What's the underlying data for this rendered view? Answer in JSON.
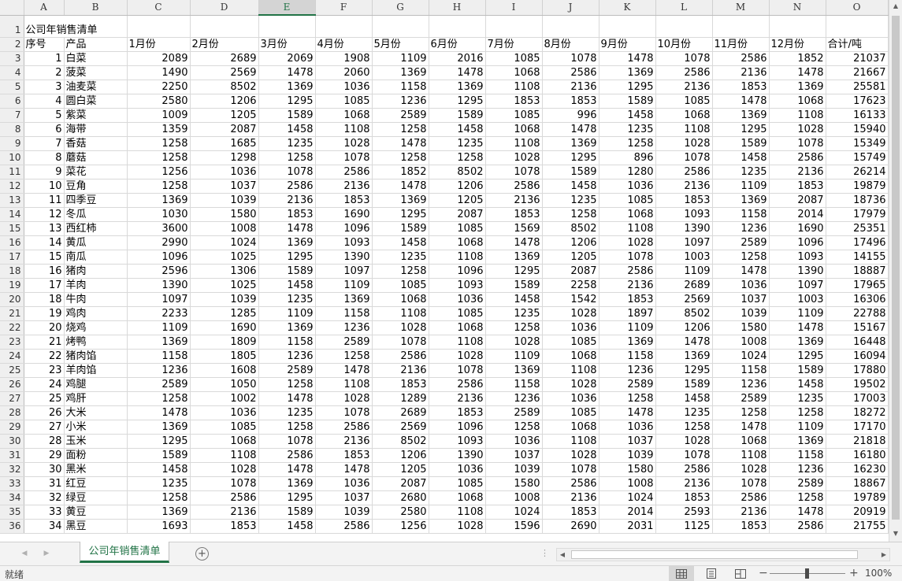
{
  "sheet": {
    "columns": [
      "A",
      "B",
      "C",
      "D",
      "E",
      "F",
      "G",
      "H",
      "I",
      "J",
      "K",
      "L",
      "M",
      "N",
      "O"
    ],
    "selected_column": "E",
    "title": "公司年销售清单",
    "header": [
      "序号",
      "产品",
      "1月份",
      "2月份",
      "3月份",
      "4月份",
      "5月份",
      "6月份",
      "7月份",
      "8月份",
      "9月份",
      "10月份",
      "11月份",
      "12月份",
      "合计/吨"
    ],
    "rows": [
      [
        "1",
        "白菜",
        "2089",
        "2689",
        "2069",
        "1908",
        "1109",
        "2016",
        "1085",
        "1078",
        "1478",
        "1078",
        "2586",
        "1852",
        "21037"
      ],
      [
        "2",
        "菠菜",
        "1490",
        "2569",
        "1478",
        "2060",
        "1369",
        "1478",
        "1068",
        "2586",
        "1369",
        "2586",
        "2136",
        "1478",
        "21667"
      ],
      [
        "3",
        "油麦菜",
        "2250",
        "8502",
        "1369",
        "1036",
        "1158",
        "1369",
        "1108",
        "2136",
        "1295",
        "2136",
        "1853",
        "1369",
        "25581"
      ],
      [
        "4",
        "圆白菜",
        "2580",
        "1206",
        "1295",
        "1085",
        "1236",
        "1295",
        "1853",
        "1853",
        "1589",
        "1085",
        "1478",
        "1068",
        "17623"
      ],
      [
        "5",
        "紫菜",
        "1009",
        "1205",
        "1589",
        "1068",
        "2589",
        "1589",
        "1085",
        "996",
        "1458",
        "1068",
        "1369",
        "1108",
        "16133"
      ],
      [
        "6",
        "海带",
        "1359",
        "2087",
        "1458",
        "1108",
        "1258",
        "1458",
        "1068",
        "1478",
        "1235",
        "1108",
        "1295",
        "1028",
        "15940"
      ],
      [
        "7",
        "香菇",
        "1258",
        "1685",
        "1235",
        "1028",
        "1478",
        "1235",
        "1108",
        "1369",
        "1258",
        "1028",
        "1589",
        "1078",
        "15349"
      ],
      [
        "8",
        "蘑菇",
        "1258",
        "1298",
        "1258",
        "1078",
        "1258",
        "1258",
        "1028",
        "1295",
        "896",
        "1078",
        "1458",
        "2586",
        "15749"
      ],
      [
        "9",
        "菜花",
        "1256",
        "1036",
        "1078",
        "2586",
        "1852",
        "8502",
        "1078",
        "1589",
        "1280",
        "2586",
        "1235",
        "2136",
        "26214"
      ],
      [
        "10",
        "豆角",
        "1258",
        "1037",
        "2586",
        "2136",
        "1478",
        "1206",
        "2586",
        "1458",
        "1036",
        "2136",
        "1109",
        "1853",
        "19879"
      ],
      [
        "11",
        "四季豆",
        "1369",
        "1039",
        "2136",
        "1853",
        "1369",
        "1205",
        "2136",
        "1235",
        "1085",
        "1853",
        "1369",
        "2087",
        "18736"
      ],
      [
        "12",
        "冬瓜",
        "1030",
        "1580",
        "1853",
        "1690",
        "1295",
        "2087",
        "1853",
        "1258",
        "1068",
        "1093",
        "1158",
        "2014",
        "17979"
      ],
      [
        "13",
        "西红柿",
        "3600",
        "1008",
        "1478",
        "1096",
        "1589",
        "1085",
        "1569",
        "8502",
        "1108",
        "1390",
        "1236",
        "1690",
        "25351"
      ],
      [
        "14",
        "黄瓜",
        "2990",
        "1024",
        "1369",
        "1093",
        "1458",
        "1068",
        "1478",
        "1206",
        "1028",
        "1097",
        "2589",
        "1096",
        "17496"
      ],
      [
        "15",
        "南瓜",
        "1096",
        "1025",
        "1295",
        "1390",
        "1235",
        "1108",
        "1369",
        "1205",
        "1078",
        "1003",
        "1258",
        "1093",
        "14155"
      ],
      [
        "16",
        "猪肉",
        "2596",
        "1306",
        "1589",
        "1097",
        "1258",
        "1096",
        "1295",
        "2087",
        "2586",
        "1109",
        "1478",
        "1390",
        "18887"
      ],
      [
        "17",
        "羊肉",
        "1390",
        "1025",
        "1458",
        "1109",
        "1085",
        "1093",
        "1589",
        "2258",
        "2136",
        "2689",
        "1036",
        "1097",
        "17965"
      ],
      [
        "18",
        "牛肉",
        "1097",
        "1039",
        "1235",
        "1369",
        "1068",
        "1036",
        "1458",
        "1542",
        "1853",
        "2569",
        "1037",
        "1003",
        "16306"
      ],
      [
        "19",
        "鸡肉",
        "2233",
        "1285",
        "1109",
        "1158",
        "1108",
        "1085",
        "1235",
        "1028",
        "1897",
        "8502",
        "1039",
        "1109",
        "22788"
      ],
      [
        "20",
        "烧鸡",
        "1109",
        "1690",
        "1369",
        "1236",
        "1028",
        "1068",
        "1258",
        "1036",
        "1109",
        "1206",
        "1580",
        "1478",
        "15167"
      ],
      [
        "21",
        "烤鸭",
        "1369",
        "1809",
        "1158",
        "2589",
        "1078",
        "1108",
        "1028",
        "1085",
        "1369",
        "1478",
        "1008",
        "1369",
        "16448"
      ],
      [
        "22",
        "猪肉馅",
        "1158",
        "1805",
        "1236",
        "1258",
        "2586",
        "1028",
        "1109",
        "1068",
        "1158",
        "1369",
        "1024",
        "1295",
        "16094"
      ],
      [
        "23",
        "羊肉馅",
        "1236",
        "1608",
        "2589",
        "1478",
        "2136",
        "1078",
        "1369",
        "1108",
        "1236",
        "1295",
        "1158",
        "1589",
        "17880"
      ],
      [
        "24",
        "鸡腿",
        "2589",
        "1050",
        "1258",
        "1108",
        "1853",
        "2586",
        "1158",
        "1028",
        "2589",
        "1589",
        "1236",
        "1458",
        "19502"
      ],
      [
        "25",
        "鸡肝",
        "1258",
        "1002",
        "1478",
        "1028",
        "1289",
        "2136",
        "1236",
        "1036",
        "1258",
        "1458",
        "2589",
        "1235",
        "17003"
      ],
      [
        "26",
        "大米",
        "1478",
        "1036",
        "1235",
        "1078",
        "2689",
        "1853",
        "2589",
        "1085",
        "1478",
        "1235",
        "1258",
        "1258",
        "18272"
      ],
      [
        "27",
        "小米",
        "1369",
        "1085",
        "1258",
        "2586",
        "2569",
        "1096",
        "1258",
        "1068",
        "1036",
        "1258",
        "1478",
        "1109",
        "17170"
      ],
      [
        "28",
        "玉米",
        "1295",
        "1068",
        "1078",
        "2136",
        "8502",
        "1093",
        "1036",
        "1108",
        "1037",
        "1028",
        "1068",
        "1369",
        "21818"
      ],
      [
        "29",
        "面粉",
        "1589",
        "1108",
        "2586",
        "1853",
        "1206",
        "1390",
        "1037",
        "1028",
        "1039",
        "1078",
        "1108",
        "1158",
        "16180"
      ],
      [
        "30",
        "黑米",
        "1458",
        "1028",
        "1478",
        "1478",
        "1205",
        "1036",
        "1039",
        "1078",
        "1580",
        "2586",
        "1028",
        "1236",
        "16230"
      ],
      [
        "31",
        "红豆",
        "1235",
        "1078",
        "1369",
        "1036",
        "2087",
        "1085",
        "1580",
        "2586",
        "1008",
        "2136",
        "1078",
        "2589",
        "18867"
      ],
      [
        "32",
        "绿豆",
        "1258",
        "2586",
        "1295",
        "1037",
        "2680",
        "1068",
        "1008",
        "2136",
        "1024",
        "1853",
        "2586",
        "1258",
        "19789"
      ],
      [
        "33",
        "黄豆",
        "1369",
        "2136",
        "1589",
        "1039",
        "2580",
        "1108",
        "1024",
        "1853",
        "2014",
        "2593",
        "2136",
        "1478",
        "20919"
      ],
      [
        "34",
        "黑豆",
        "1693",
        "1853",
        "1458",
        "2586",
        "1256",
        "1028",
        "1596",
        "2690",
        "2031",
        "1125",
        "1853",
        "2586",
        "21755"
      ]
    ]
  },
  "tabs": {
    "active_sheet": "公司年销售清单",
    "add_symbol": "+"
  },
  "status": {
    "text": "就绪",
    "zoom_level": "100%",
    "zoom_minus": "−",
    "zoom_plus": "+"
  },
  "colors": {
    "accent": "#217346",
    "header_bg": "#efefef",
    "gridline": "#d9d9d9"
  }
}
